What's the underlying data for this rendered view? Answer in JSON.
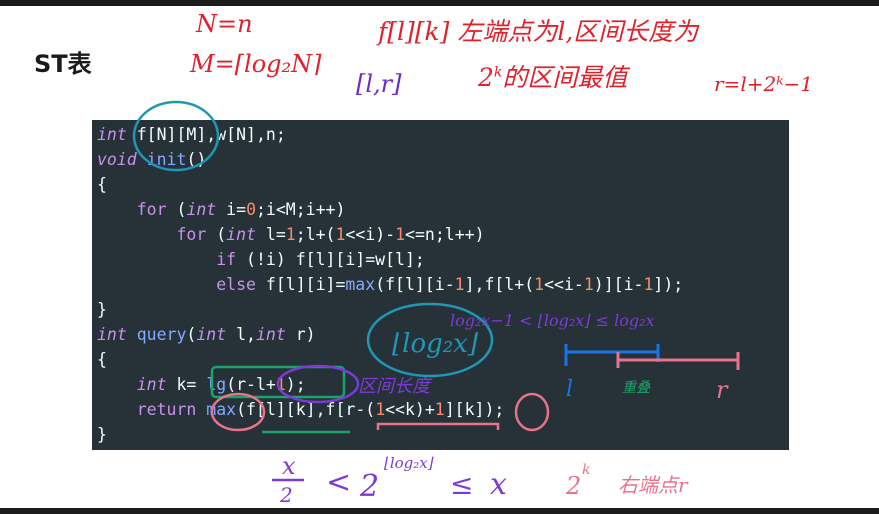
{
  "slide": {
    "title": "ST表"
  },
  "notes": {
    "n_eq": "N=n",
    "m_eq": "M=⌈log₂N⌉",
    "f_def_1": "f[l][k] 左端点为l,区间长度为",
    "interval": "[l,r]",
    "f_def_2_base": "2",
    "f_def_2_exp": "k",
    "f_def_2_rest": "的区间最值",
    "r_eq": "r=l+2ᵏ−1",
    "log_box": "⌊log₂x⌋",
    "ineq_top": "log₂x−1 < ⌊log₂x⌋ ≤ log₂x",
    "interval_len": "区间长度",
    "seg_l": "l",
    "seg_r": "r",
    "seg_mid": "重叠",
    "bottom_x": "x",
    "bottom_den": "2",
    "bottom_lt": "<",
    "bottom_base": "2",
    "bottom_exp": "⌊log₂x⌋",
    "bottom_le": "≤",
    "bottom_rhs": "x",
    "right_base": "2",
    "right_exp": "k",
    "right_text": "右端点r"
  },
  "code": [
    [
      {
        "t": "int",
        "c": "kw"
      },
      {
        "t": " f[N][M],w[N],n;",
        "c": "pl"
      }
    ],
    [
      {
        "t": "void",
        "c": "kw"
      },
      {
        "t": " ",
        "c": "pl"
      },
      {
        "t": "init",
        "c": "fn"
      },
      {
        "t": "()",
        "c": "pl"
      }
    ],
    [
      {
        "t": "{",
        "c": "pl"
      }
    ],
    [
      {
        "t": "    ",
        "c": "pl"
      },
      {
        "t": "for",
        "c": "ct"
      },
      {
        "t": " (",
        "c": "pl"
      },
      {
        "t": "int",
        "c": "kw"
      },
      {
        "t": " i=",
        "c": "pl"
      },
      {
        "t": "0",
        "c": "num"
      },
      {
        "t": ";i<M;i++)",
        "c": "pl"
      }
    ],
    [
      {
        "t": "        ",
        "c": "pl"
      },
      {
        "t": "for",
        "c": "ct"
      },
      {
        "t": " (",
        "c": "pl"
      },
      {
        "t": "int",
        "c": "kw"
      },
      {
        "t": " l=",
        "c": "pl"
      },
      {
        "t": "1",
        "c": "num"
      },
      {
        "t": ";l+(",
        "c": "pl"
      },
      {
        "t": "1",
        "c": "num"
      },
      {
        "t": "<<i)-",
        "c": "pl"
      },
      {
        "t": "1",
        "c": "num"
      },
      {
        "t": "<=n;l++)",
        "c": "pl"
      }
    ],
    [
      {
        "t": "            ",
        "c": "pl"
      },
      {
        "t": "if",
        "c": "ct"
      },
      {
        "t": " (!i) f[l][i]=w[l];",
        "c": "pl"
      }
    ],
    [
      {
        "t": "            ",
        "c": "pl"
      },
      {
        "t": "else",
        "c": "ct"
      },
      {
        "t": " f[l][i]=",
        "c": "pl"
      },
      {
        "t": "max",
        "c": "fn"
      },
      {
        "t": "(f[l][i-",
        "c": "pl"
      },
      {
        "t": "1",
        "c": "num"
      },
      {
        "t": "],f[l+(",
        "c": "pl"
      },
      {
        "t": "1",
        "c": "num"
      },
      {
        "t": "<<i-",
        "c": "pl"
      },
      {
        "t": "1",
        "c": "num"
      },
      {
        "t": ")][i-",
        "c": "pl"
      },
      {
        "t": "1",
        "c": "num"
      },
      {
        "t": "]);",
        "c": "pl"
      }
    ],
    [
      {
        "t": "}",
        "c": "pl"
      }
    ],
    [
      {
        "t": "int",
        "c": "kw"
      },
      {
        "t": " ",
        "c": "pl"
      },
      {
        "t": "query",
        "c": "fn"
      },
      {
        "t": "(",
        "c": "pl"
      },
      {
        "t": "int",
        "c": "kw"
      },
      {
        "t": " l,",
        "c": "pl"
      },
      {
        "t": "int",
        "c": "kw"
      },
      {
        "t": " r)",
        "c": "pl"
      }
    ],
    [
      {
        "t": "{",
        "c": "pl"
      }
    ],
    [
      {
        "t": "    ",
        "c": "pl"
      },
      {
        "t": "int",
        "c": "kw"
      },
      {
        "t": " k= ",
        "c": "pl"
      },
      {
        "t": "lg",
        "c": "fn"
      },
      {
        "t": "(r-l+",
        "c": "pl"
      },
      {
        "t": "1",
        "c": "num"
      },
      {
        "t": ");",
        "c": "pl"
      }
    ],
    [
      {
        "t": "    ",
        "c": "pl"
      },
      {
        "t": "return",
        "c": "ct"
      },
      {
        "t": " ",
        "c": "pl"
      },
      {
        "t": "max",
        "c": "fn"
      },
      {
        "t": "(f[l][k],f[r-(",
        "c": "pl"
      },
      {
        "t": "1",
        "c": "num"
      },
      {
        "t": "<<k)+",
        "c": "pl"
      },
      {
        "t": "1",
        "c": "num"
      },
      {
        "t": "][k]);",
        "c": "pl"
      }
    ],
    [
      {
        "t": "}",
        "c": "pl"
      }
    ]
  ],
  "colors": {
    "panel_bg": "#263238",
    "keyword": "#c792ea",
    "function": "#82aaff",
    "number": "#f78c6c",
    "plain": "#eeffff",
    "ink_red": "#e0202a",
    "ink_purple": "#6a2bc8",
    "ink_teal": "#1f97b5",
    "ink_green": "#1aa36a",
    "ink_pink": "#e8738a",
    "ink_blue": "#1a73e8"
  }
}
